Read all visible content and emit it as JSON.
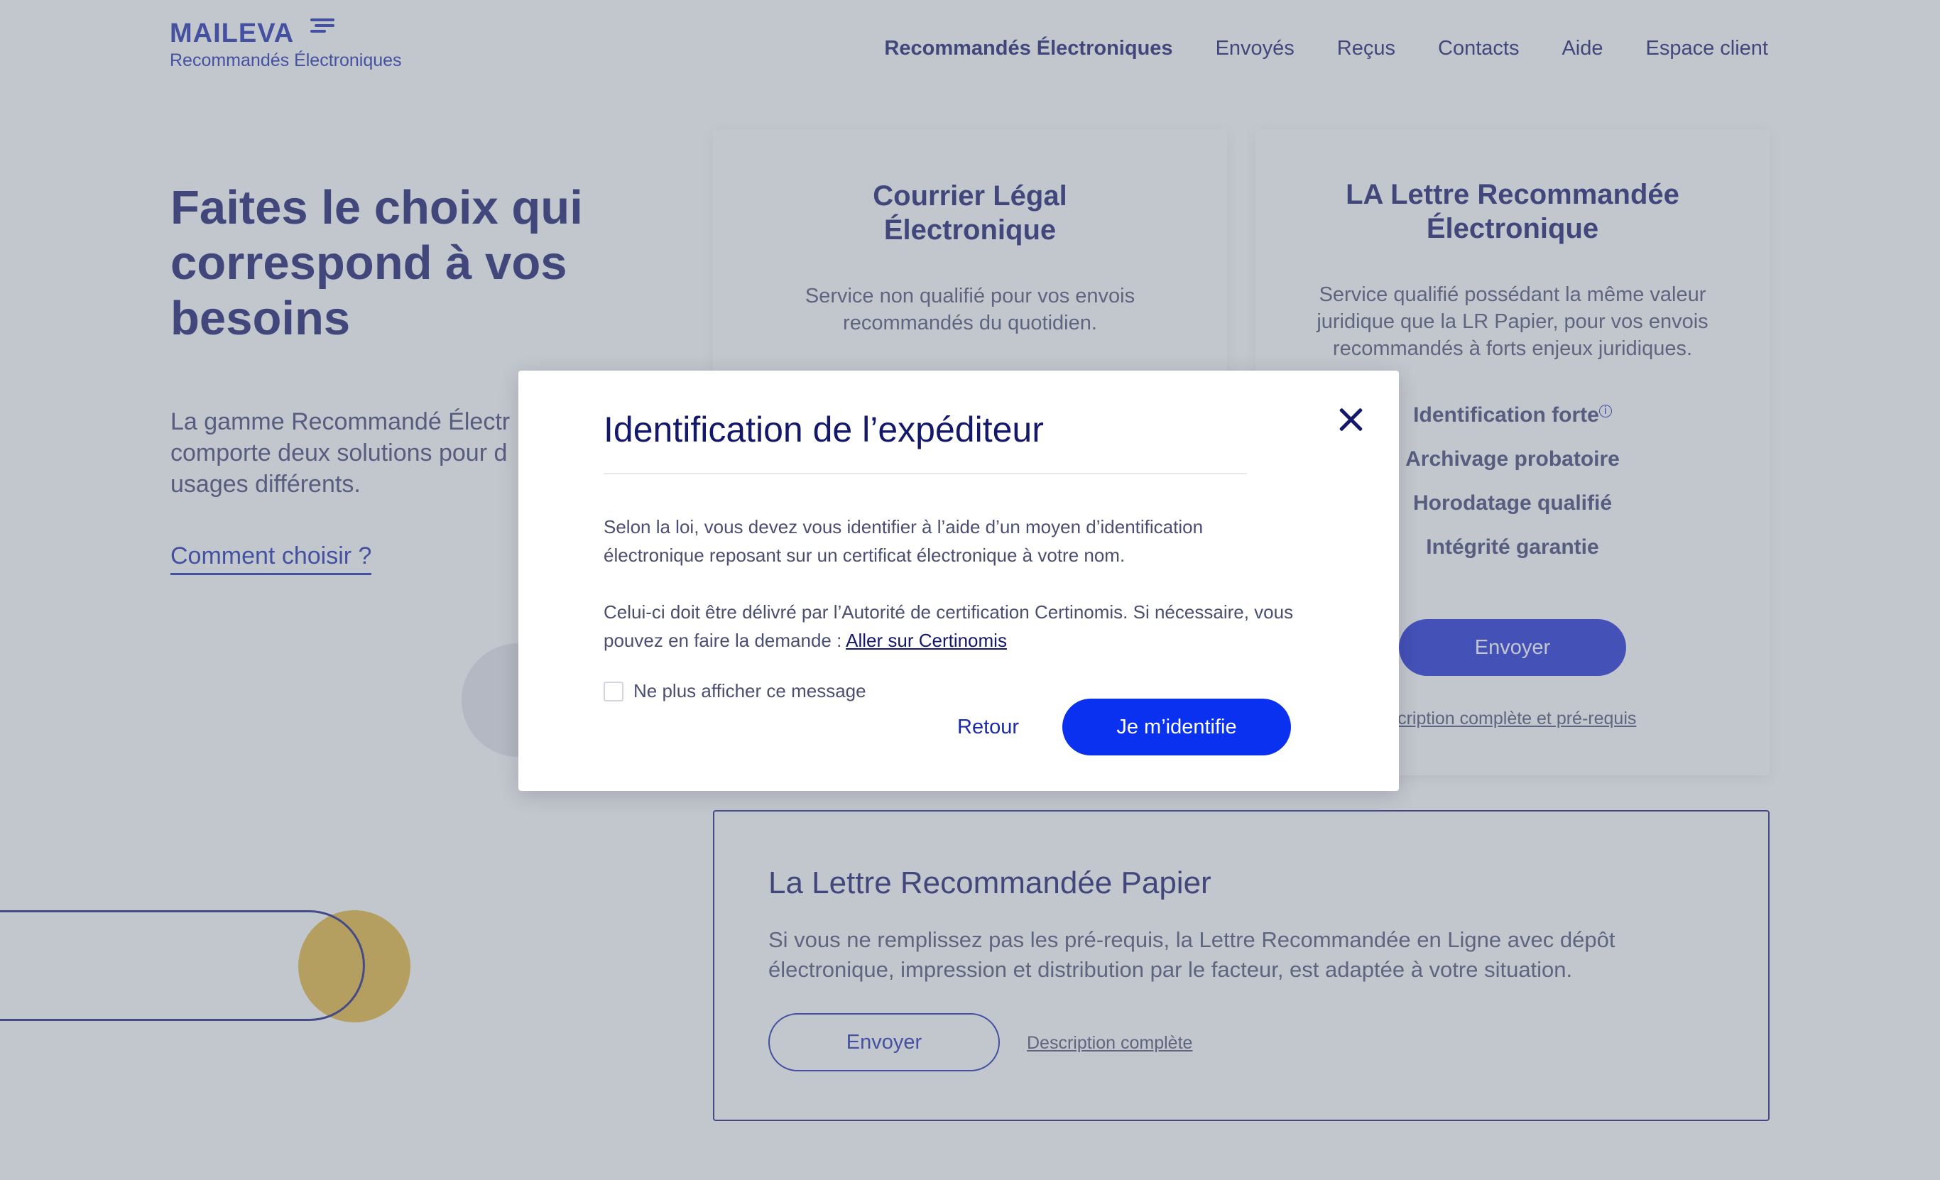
{
  "header": {
    "logo": "MAILEVA",
    "logo_sub": "Recommandés Électroniques",
    "nav": [
      {
        "label": "Recommandés Électroniques",
        "active": true
      },
      {
        "label": "Envoyés"
      },
      {
        "label": "Reçus"
      },
      {
        "label": "Contacts"
      },
      {
        "label": "Aide"
      },
      {
        "label": "Espace client"
      }
    ]
  },
  "hero": {
    "title": "Faites le choix qui correspond à vos besoins",
    "text": "La gamme Recommandé Électr\ncomporte deux solutions pour d\nusages différents.",
    "link": "Comment choisir ?"
  },
  "cards": {
    "courrier": {
      "title": "Courrier Légal\nÉlectronique",
      "desc": "Service non qualifié pour vos envois\nrecommandés du quotidien."
    },
    "lre": {
      "title": "LA Lettre Recommandée\nÉlectronique",
      "desc": "Service qualifié possédant la même valeur\njuridique que la LR Papier, pour vos envois\nrecommandés à forts enjeux juridiques.",
      "features": [
        "Identification forte",
        "Archivage probatoire",
        "Horodatage qualifié",
        "Intégrité garantie"
      ],
      "info_marker": "i",
      "button": "Envoyer",
      "link": "scription complète et pré-requis"
    },
    "papier": {
      "title": "La Lettre Recommandée Papier",
      "desc": "Si vous ne remplissez pas les pré-requis, la Lettre Recommandée en Ligne avec dépôt\nélectronique, impression et distribution par le facteur, est adaptée à votre situation.",
      "button": "Envoyer",
      "link": "Description complète"
    }
  },
  "modal": {
    "title": "Identification de l’expéditeur",
    "p1": "Selon la loi, vous devez vous identifier à l’aide d’un moyen d’identification\nélectronique reposant sur un certificat électronique à votre nom.",
    "p2": "Celui-ci doit être délivré par l’Autorité de certification Certinomis. Si nécessaire, vous pouvez en faire la demande : ",
    "p2_link": "Aller sur Certinomis",
    "checkbox_label": "Ne plus afficher ce message",
    "back": "Retour",
    "confirm": "Je m’identifie"
  },
  "colors": {
    "brand_blue": "#1a2ab0",
    "navy": "#14186b",
    "accent_yellow": "#e5b73a",
    "button_blue": "#0a30f0"
  }
}
